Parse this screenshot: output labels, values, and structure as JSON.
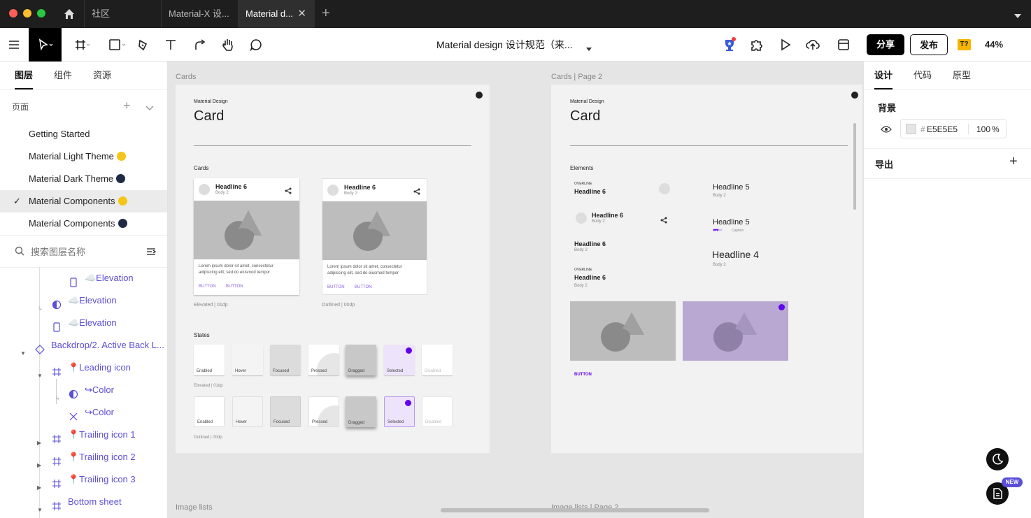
{
  "tabs": {
    "home": "社区",
    "tab1": "Material-X 设...",
    "tab2": "Material d..."
  },
  "toolbar": {
    "file_title": "Material design 设计规范（来...",
    "share": "分享",
    "publish": "发布",
    "zoom": "44%",
    "tt_badge": "T?"
  },
  "left_panel": {
    "tabs": [
      "图层",
      "组件",
      "资源"
    ],
    "pages_label": "页面",
    "pages": [
      {
        "name": "Getting Started",
        "emoji": ""
      },
      {
        "name": "Material Light Theme",
        "emoji": "#f5c518"
      },
      {
        "name": "Material Dark Theme",
        "emoji": "#1f2a44"
      },
      {
        "name": "Material Components",
        "emoji": "#f5c518",
        "selected": true
      },
      {
        "name": "Material Components",
        "emoji": "#1f2a44"
      }
    ],
    "search_placeholder": "搜索图层名称",
    "layers": [
      {
        "label": "☁️Elevation"
      },
      {
        "label": "☁️Elevation"
      },
      {
        "label": "☁️Elevation"
      },
      {
        "label": "Backdrop/2. Active Back L..."
      },
      {
        "label": "📍Leading icon"
      },
      {
        "label": "↪Color"
      },
      {
        "label": "↪Color"
      },
      {
        "label": "📍Trailing icon 1"
      },
      {
        "label": "📍Trailing icon 2"
      },
      {
        "label": "📍Trailing icon 3"
      },
      {
        "label": "Bottom sheet"
      }
    ]
  },
  "right_panel": {
    "tabs": [
      "设计",
      "代码",
      "原型"
    ],
    "background_label": "背景",
    "hash": "#",
    "bg_color": "E5E5E5",
    "opacity": "100",
    "opacity_unit": "%",
    "export_label": "导出",
    "new_badge": "NEW"
  },
  "canvas": {
    "frame1_label": "Cards",
    "frame2_label": "Cards | Page 2",
    "bottom_label1": "Image lists",
    "bottom_label2": "Image lists | Page 2",
    "frame1": {
      "overline": "Material Design",
      "title": "Card",
      "section1": "Cards",
      "card_headline": "Headline 6",
      "card_sub": "Body 2",
      "card_body1": "Lorem ipsum dolor sit amet, consectetur",
      "card_body2": "adipiscing elit, sed do eiusmod tempor",
      "card_btn": "BUTTON",
      "cap1": "Elevated | 01dp",
      "cap2": "Outlined | 00dp",
      "states_label": "States",
      "states": [
        "Enabled",
        "Hover",
        "Focused",
        "Pressed",
        "Dragged",
        "Selected",
        "Disabled"
      ],
      "states_cap1": "Elevated | 01dp",
      "states_cap2": "Outlined | 00dp"
    },
    "frame2": {
      "overline": "Material Design",
      "title": "Card",
      "section": "Elements",
      "overline_small": "OVERLINE",
      "h6": "Headline 6",
      "h5": "Headline 5",
      "h4": "Headline 4",
      "body2": "Body 2",
      "caption": "Caption",
      "button": "BUTTON"
    }
  },
  "colors": {
    "accent": "#5b4fd6",
    "purple": "#6200ee",
    "selected_tint": "#ede4fb"
  }
}
